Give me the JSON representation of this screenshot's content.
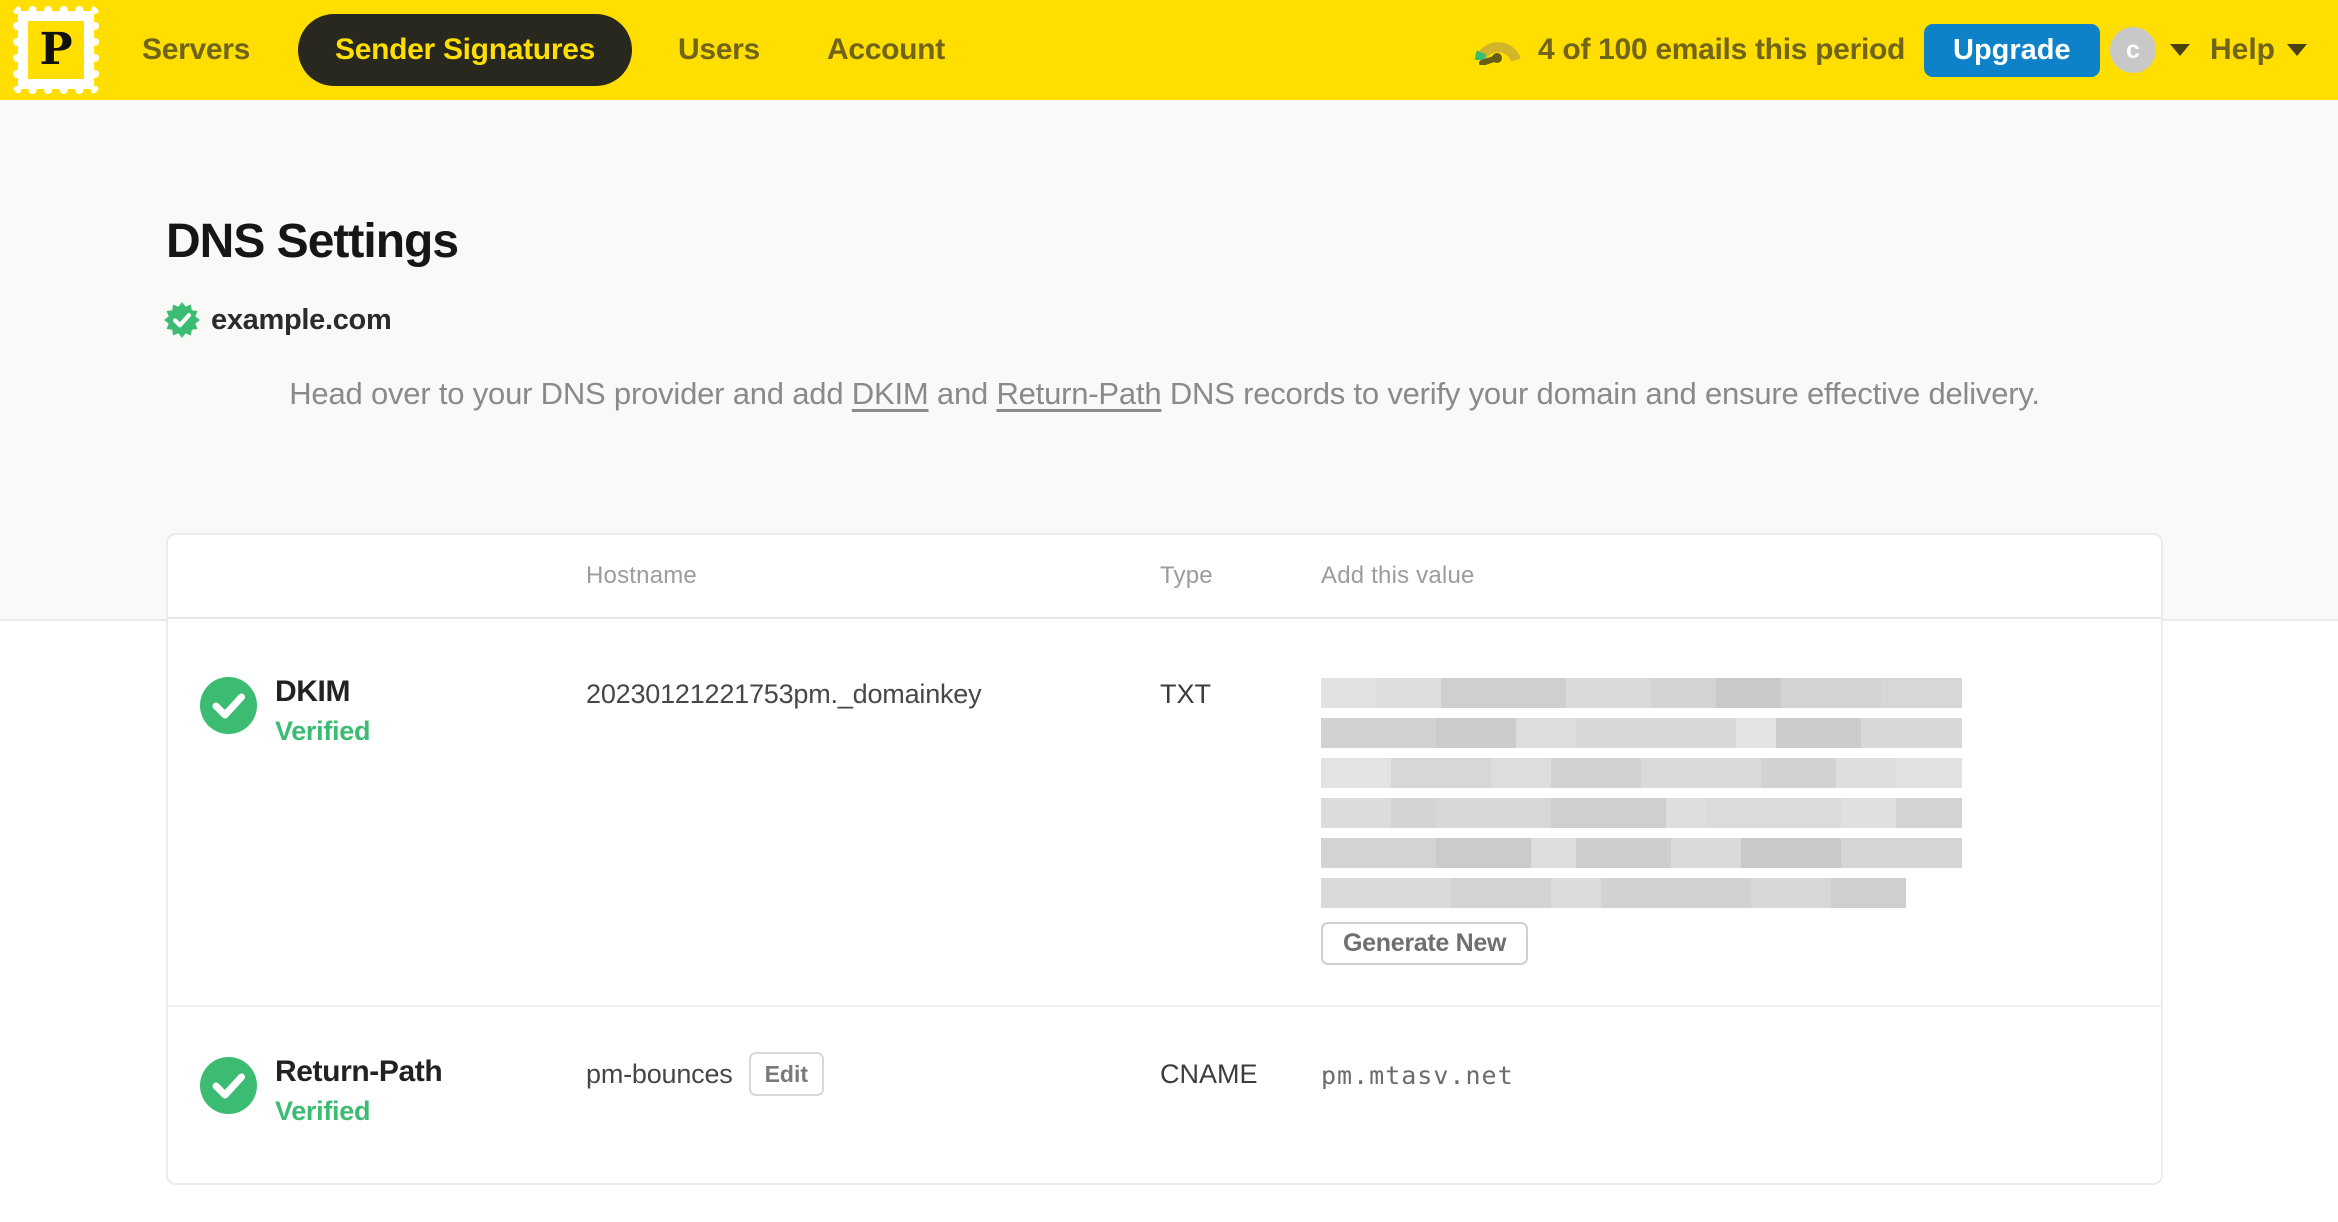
{
  "navbar": {
    "logo_letter": "P",
    "items": [
      {
        "label": "Servers",
        "active": false
      },
      {
        "label": "Sender Signatures",
        "active": true
      },
      {
        "label": "Users",
        "active": false
      },
      {
        "label": "Account",
        "active": false
      }
    ],
    "usage_text": "4 of 100 emails this period",
    "upgrade_label": "Upgrade",
    "avatar_letter": "c",
    "help_label": "Help"
  },
  "page": {
    "title": "DNS Settings",
    "domain": "example.com",
    "description": {
      "pre": "Head over to your DNS provider and add ",
      "link_dkim": "DKIM",
      "mid": " and ",
      "link_return_path": "Return-Path",
      "post": " DNS records to verify your domain and ensure effective delivery."
    }
  },
  "table": {
    "headers": {
      "hostname": "Hostname",
      "type": "Type",
      "value": "Add this value"
    },
    "rows": [
      {
        "name": "DKIM",
        "status": "Verified",
        "hostname": "20230121221753pm._domainkey",
        "type": "TXT",
        "value_redacted": true,
        "action_label": "Generate New"
      },
      {
        "name": "Return-Path",
        "status": "Verified",
        "hostname": "pm-bounces",
        "hostname_action_label": "Edit",
        "type": "CNAME",
        "value": "pm.mtasv.net"
      }
    ]
  },
  "colors": {
    "brand_yellow": "#FFDE00",
    "upgrade_blue": "#0D82C8",
    "verified_green": "#3CBC73",
    "nav_text_olive": "#6F6418",
    "active_pill_bg": "#28281F"
  }
}
